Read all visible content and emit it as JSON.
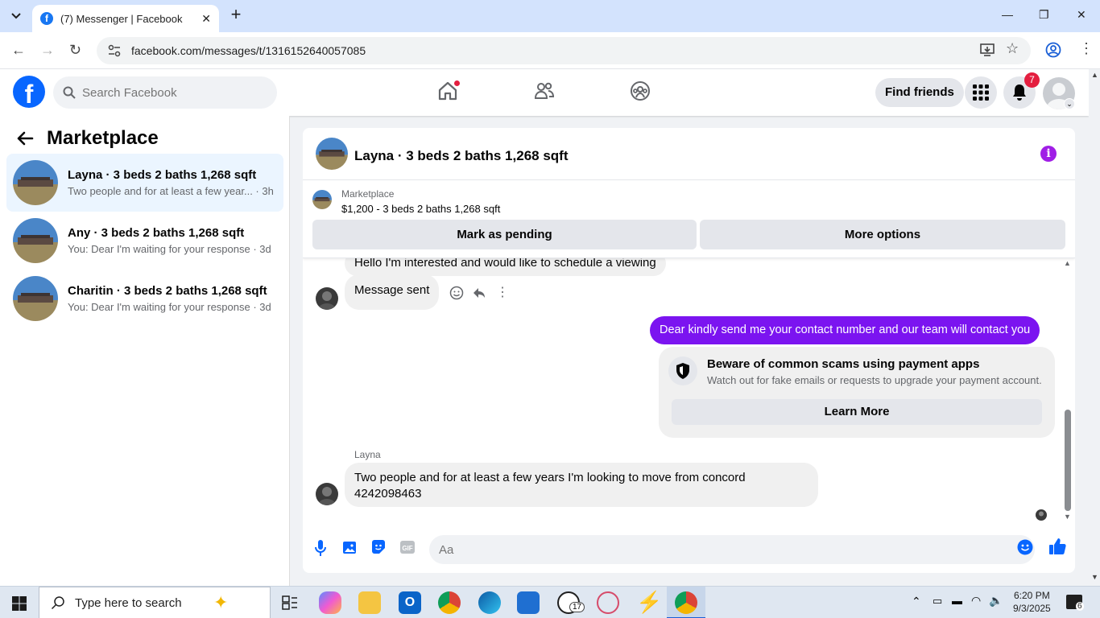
{
  "browser": {
    "tab_title": "(7) Messenger | Facebook",
    "url": "facebook.com/messages/t/1316152640057085"
  },
  "fb_header": {
    "logo_letter": "f",
    "search_placeholder": "Search Facebook",
    "find_friends_label": "Find friends",
    "notifications_count": "7",
    "brand_color": "#0866ff",
    "notification_badge_color": "#e41e3f"
  },
  "left_panel": {
    "title": "Marketplace",
    "conversations": [
      {
        "name": "Layna · 3 beds 2 baths 1,268 sqft",
        "preview": "Two people and for at least a few year... · 3h",
        "active": true
      },
      {
        "name": "Any · 3 beds 2 baths 1,268 sqft",
        "preview": "You: Dear I'm waiting for your response · 3d",
        "active": false
      },
      {
        "name": "Charitin · 3 beds 2 baths 1,268 sqft",
        "preview": "You: Dear I'm waiting for your response · 3d",
        "active": false
      }
    ]
  },
  "chat": {
    "title": "Layna · 3 beds 2 baths 1,268 sqft",
    "marketplace_label": "Marketplace",
    "listing_price": "$1,200 - 3 beds 2 baths 1,268 sqft",
    "mark_pending_label": "Mark as pending",
    "more_options_label": "More options",
    "messages": {
      "partial_incoming": "Hello I'm interested and would like to schedule a viewing",
      "message_sent": "Message sent",
      "outgoing": "Dear kindly send me your contact number and our team will contact you",
      "scam_title": "Beware of common scams using payment apps",
      "scam_desc": "Watch out for fake emails or requests to upgrade your payment account.",
      "learn_more": "Learn More",
      "sender_name": "Layna",
      "incoming_line1": "Two people and for at least a few years I'm looking to move from concord",
      "incoming_line2": "4242098463"
    },
    "composer_placeholder": "Aa",
    "accent_color": "#7b14f0"
  },
  "taskbar": {
    "search_placeholder": "Type here to search",
    "time": "6:20 PM",
    "date": "9/3/2025",
    "whatsapp_badge": "17",
    "notification_count": "6"
  }
}
